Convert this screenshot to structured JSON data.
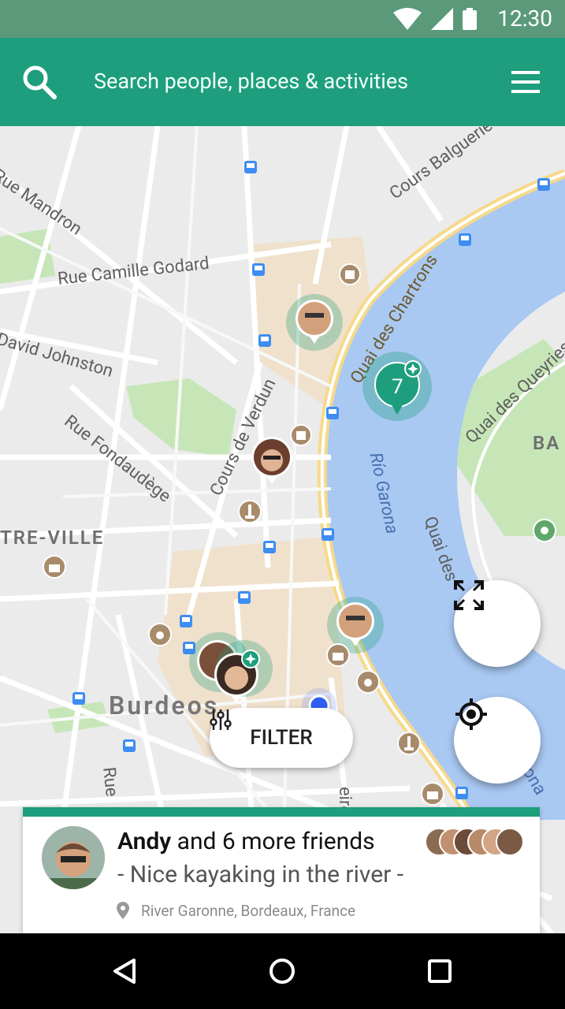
{
  "status": {
    "time": "12:30"
  },
  "appbar": {
    "search_placeholder": "Search people, places & activities"
  },
  "map": {
    "streets": [
      "Rue Mandron",
      "Rue Camille Godard",
      "David Johnston",
      "Rue Fondaudège",
      "Cours de Verdun",
      "Quai des Chartrons",
      "Cours Balguerie",
      "Quai des Queyries",
      "Quai des",
      "Rue",
      "eire"
    ],
    "areas": [
      "TRE-VILLE",
      "Burdeos",
      "BA"
    ],
    "river": "Río Garona",
    "river_partial": "arona",
    "cluster_count": "7"
  },
  "filter": {
    "label": "FILTER"
  },
  "card": {
    "name": "Andy",
    "title_rest": " and 6 more friends",
    "subtitle": "- Nice kayaking in the river -",
    "location": "River Garonne, Bordeaux, France"
  },
  "colors": {
    "primary": "#1e9e7c",
    "status": "#5a9a7a",
    "river": "#a7c8f2",
    "park": "#bfe3b1"
  }
}
